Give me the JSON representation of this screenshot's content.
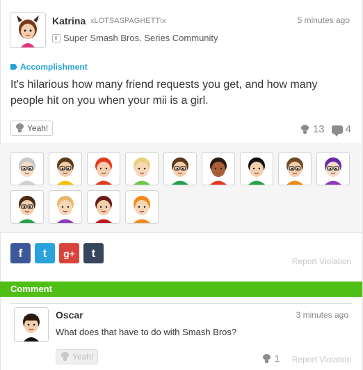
{
  "post": {
    "user_name": "Katrina",
    "user_id": "xLOTSASPAGHETTIx",
    "timestamp": "5 minutes ago",
    "community": "Super Smash Bros. Series Community",
    "topic": "Accomplishment",
    "body": "It's hilarious how many friend requests you get, and how many people hit on you when your mii is a girl.",
    "yeah_label": "Yeah!",
    "yeah_count": "13",
    "reply_count": "4"
  },
  "empathy_miis": [
    {
      "skin": "#f5dcc6",
      "hair": "#c8c8c8",
      "shirt": "#d0d0d0",
      "glasses": true
    },
    {
      "skin": "#f3cfae",
      "hair": "#5a3a1a",
      "shirt": "#f6c400",
      "glasses": true
    },
    {
      "skin": "#f3cfae",
      "hair": "#e23b1e",
      "shirt": "#e23b1e",
      "glasses": false
    },
    {
      "skin": "#f6d7b8",
      "hair": "#e8d27a",
      "shirt": "#6fc64a",
      "glasses": false
    },
    {
      "skin": "#f3cfae",
      "hair": "#5a3a1a",
      "shirt": "#27a24c",
      "glasses": true
    },
    {
      "skin": "#a8603a",
      "hair": "#2a1a10",
      "shirt": "#e23b1e",
      "glasses": false
    },
    {
      "skin": "#f3cfae",
      "hair": "#111111",
      "shirt": "#27a24c",
      "glasses": false
    },
    {
      "skin": "#f3cfae",
      "hair": "#6b4a25",
      "shirt": "#f28a1a",
      "glasses": true
    },
    {
      "skin": "#f5dcc6",
      "hair": "#6a2aa5",
      "shirt": "#8f3bc1",
      "glasses": true
    },
    {
      "skin": "#f3cfae",
      "hair": "#4a2a14",
      "shirt": "#27a24c",
      "glasses": true
    },
    {
      "skin": "#f6d7b8",
      "hair": "#e8b86a",
      "shirt": "#8f3bc1",
      "glasses": false
    },
    {
      "skin": "#f3cfae",
      "hair": "#6a1a1a",
      "shirt": "#c01818",
      "glasses": false
    },
    {
      "skin": "#f6d7b8",
      "hair": "#f28a1a",
      "shirt": "#f28a1a",
      "glasses": false
    }
  ],
  "share": {
    "facebook": "f",
    "twitter": "t",
    "google": "g+",
    "tumblr": "t"
  },
  "report_label": "Report Violation",
  "comment_section": {
    "title": "Comment",
    "user_name": "Oscar",
    "timestamp": "3 minutes ago",
    "body": "What does that have to do with Smash Bros?",
    "yeah_label": "Yeah!",
    "yeah_count": "1",
    "report_label": "Report Violation"
  },
  "colors": {
    "accent_green": "#4fbf16",
    "topic_blue": "#24a4d6",
    "facebook": "#3b5998",
    "twitter": "#2aa3dc",
    "google": "#d8433a",
    "tumblr": "#35465c"
  }
}
